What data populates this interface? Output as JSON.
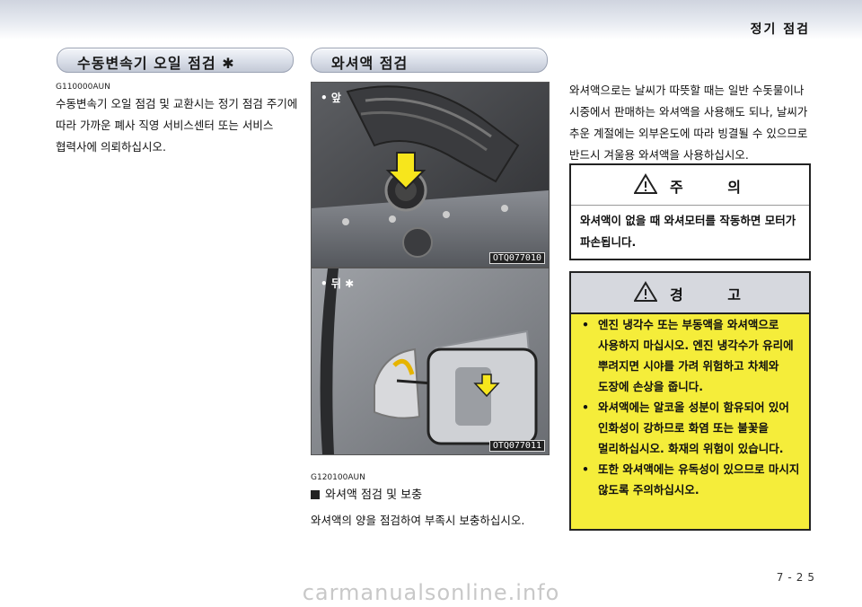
{
  "header": {
    "section": "정기 점검"
  },
  "left": {
    "title": "수동변속기 오일 점검 ✱",
    "code": "G110000AUN",
    "text": "수동변속기 오일 점검 및 교환시는 정기 점검 주기에 따라 가까운 폐사 직영 서비스센터 또는 서비스 협력사에 의뢰하십시오."
  },
  "middle": {
    "title": "와셔액 점검",
    "photo1": {
      "tag": "• 앞",
      "code": "OTQ077010"
    },
    "photo2": {
      "tag": "• 뒤 ✱",
      "code": "OTQ077011"
    },
    "code": "G120100AUN",
    "subheading": "와셔액 점검 및 보충",
    "text": "와셔액의 양을 점검하여 부족시 보충하십시오."
  },
  "right": {
    "text": "와셔액으로는 날씨가 따뜻할 때는 일반 수돗물이나 시중에서 판매하는 와셔액을 사용해도 되나, 날씨가 추운 계절에는 외부온도에 따라 빙결될 수 있으므로 반드시 겨울용 와셔액을 사용하십시오.",
    "caution": {
      "title": "주 의",
      "text": "와셔액이 없을 때 와셔모터를 작동하면 모터가 파손됩니다."
    },
    "warning": {
      "title": "경 고",
      "items": [
        "엔진 냉각수 또는 부동액을 와셔액으로 사용하지 마십시오. 엔진 냉각수가 유리에 뿌려지면 시야를 가려 위험하고 차체와 도장에 손상을 줍니다.",
        "와셔액에는 알코올 성분이 함유되어 있어 인화성이 강하므로 화염 또는 불꽃을 멀리하십시오. 화재의 위험이 있습니다.",
        "또한 와셔액에는 유독성이 있으므로 마시지 않도록 주의하십시오."
      ]
    },
    "warning_color": "#f5ed3a",
    "warning_head_color": "#d6d8de"
  },
  "footer": {
    "page": "7-25",
    "watermark": "carmanualsonline.info"
  }
}
